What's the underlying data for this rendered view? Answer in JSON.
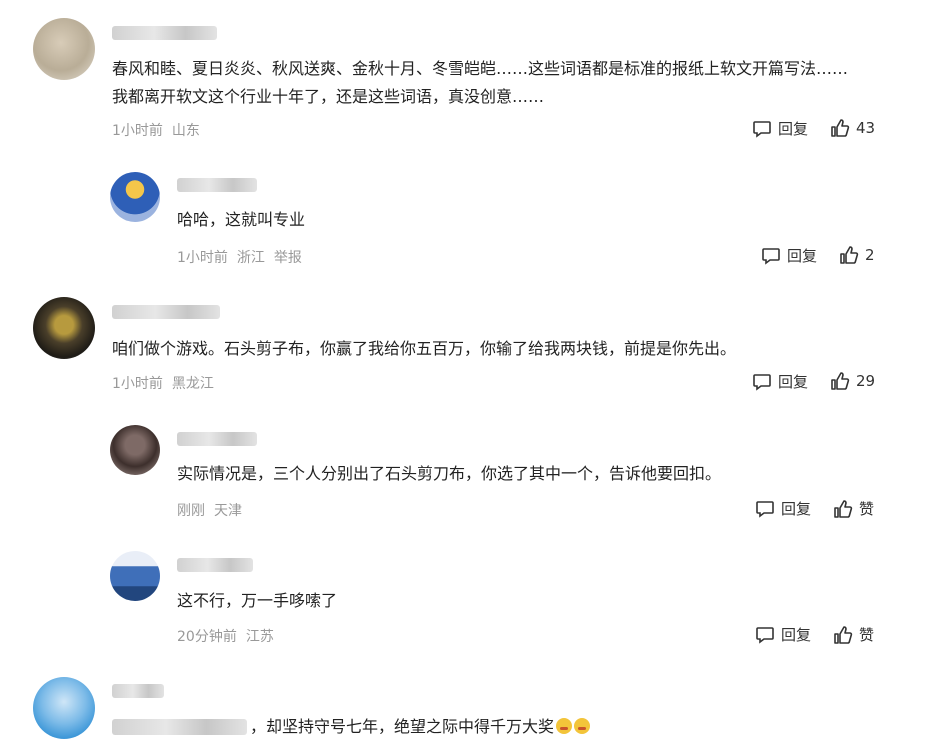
{
  "comments": [
    {
      "text_line1": "春风和睦、夏日炎炎、秋风送爽、金秋十月、冬雪皑皑……这些词语都是标准的报纸上软文开篇写法……",
      "text_line2": "我都离开软文这个行业十年了，还是这些词语，真没创意……",
      "time": "1小时前",
      "location": "山东",
      "reply_label": "回复",
      "like_count": "43"
    },
    {
      "text_line1": "哈哈，这就叫专业",
      "time": "1小时前",
      "location": "浙江",
      "report_label": "举报",
      "reply_label": "回复",
      "like_count": "2"
    },
    {
      "text_line1": "咱们做个游戏。石头剪子布，你赢了我给你五百万，你输了给我两块钱，前提是你先出。",
      "time": "1小时前",
      "location": "黑龙江",
      "reply_label": "回复",
      "like_count": "29"
    },
    {
      "text_line1": "实际情况是，三个人分别出了石头剪刀布，你选了其中一个，告诉他要回扣。",
      "time": "刚刚",
      "location": "天津",
      "reply_label": "回复",
      "like_count": "赞"
    },
    {
      "text_line1": "这不行，万一手哆嗦了",
      "time": "20分钟前",
      "location": "江苏",
      "reply_label": "回复",
      "like_count": "赞"
    },
    {
      "text_line1": "，却坚持守号七年，绝望之际中得千万大奖"
    }
  ],
  "colors": {
    "text": "#222222",
    "meta": "#999999",
    "action": "#333333"
  },
  "icons": {
    "reply": "comment-bubble-icon",
    "like": "thumbs-up-icon",
    "emoji": "smiling-face-emoji"
  }
}
